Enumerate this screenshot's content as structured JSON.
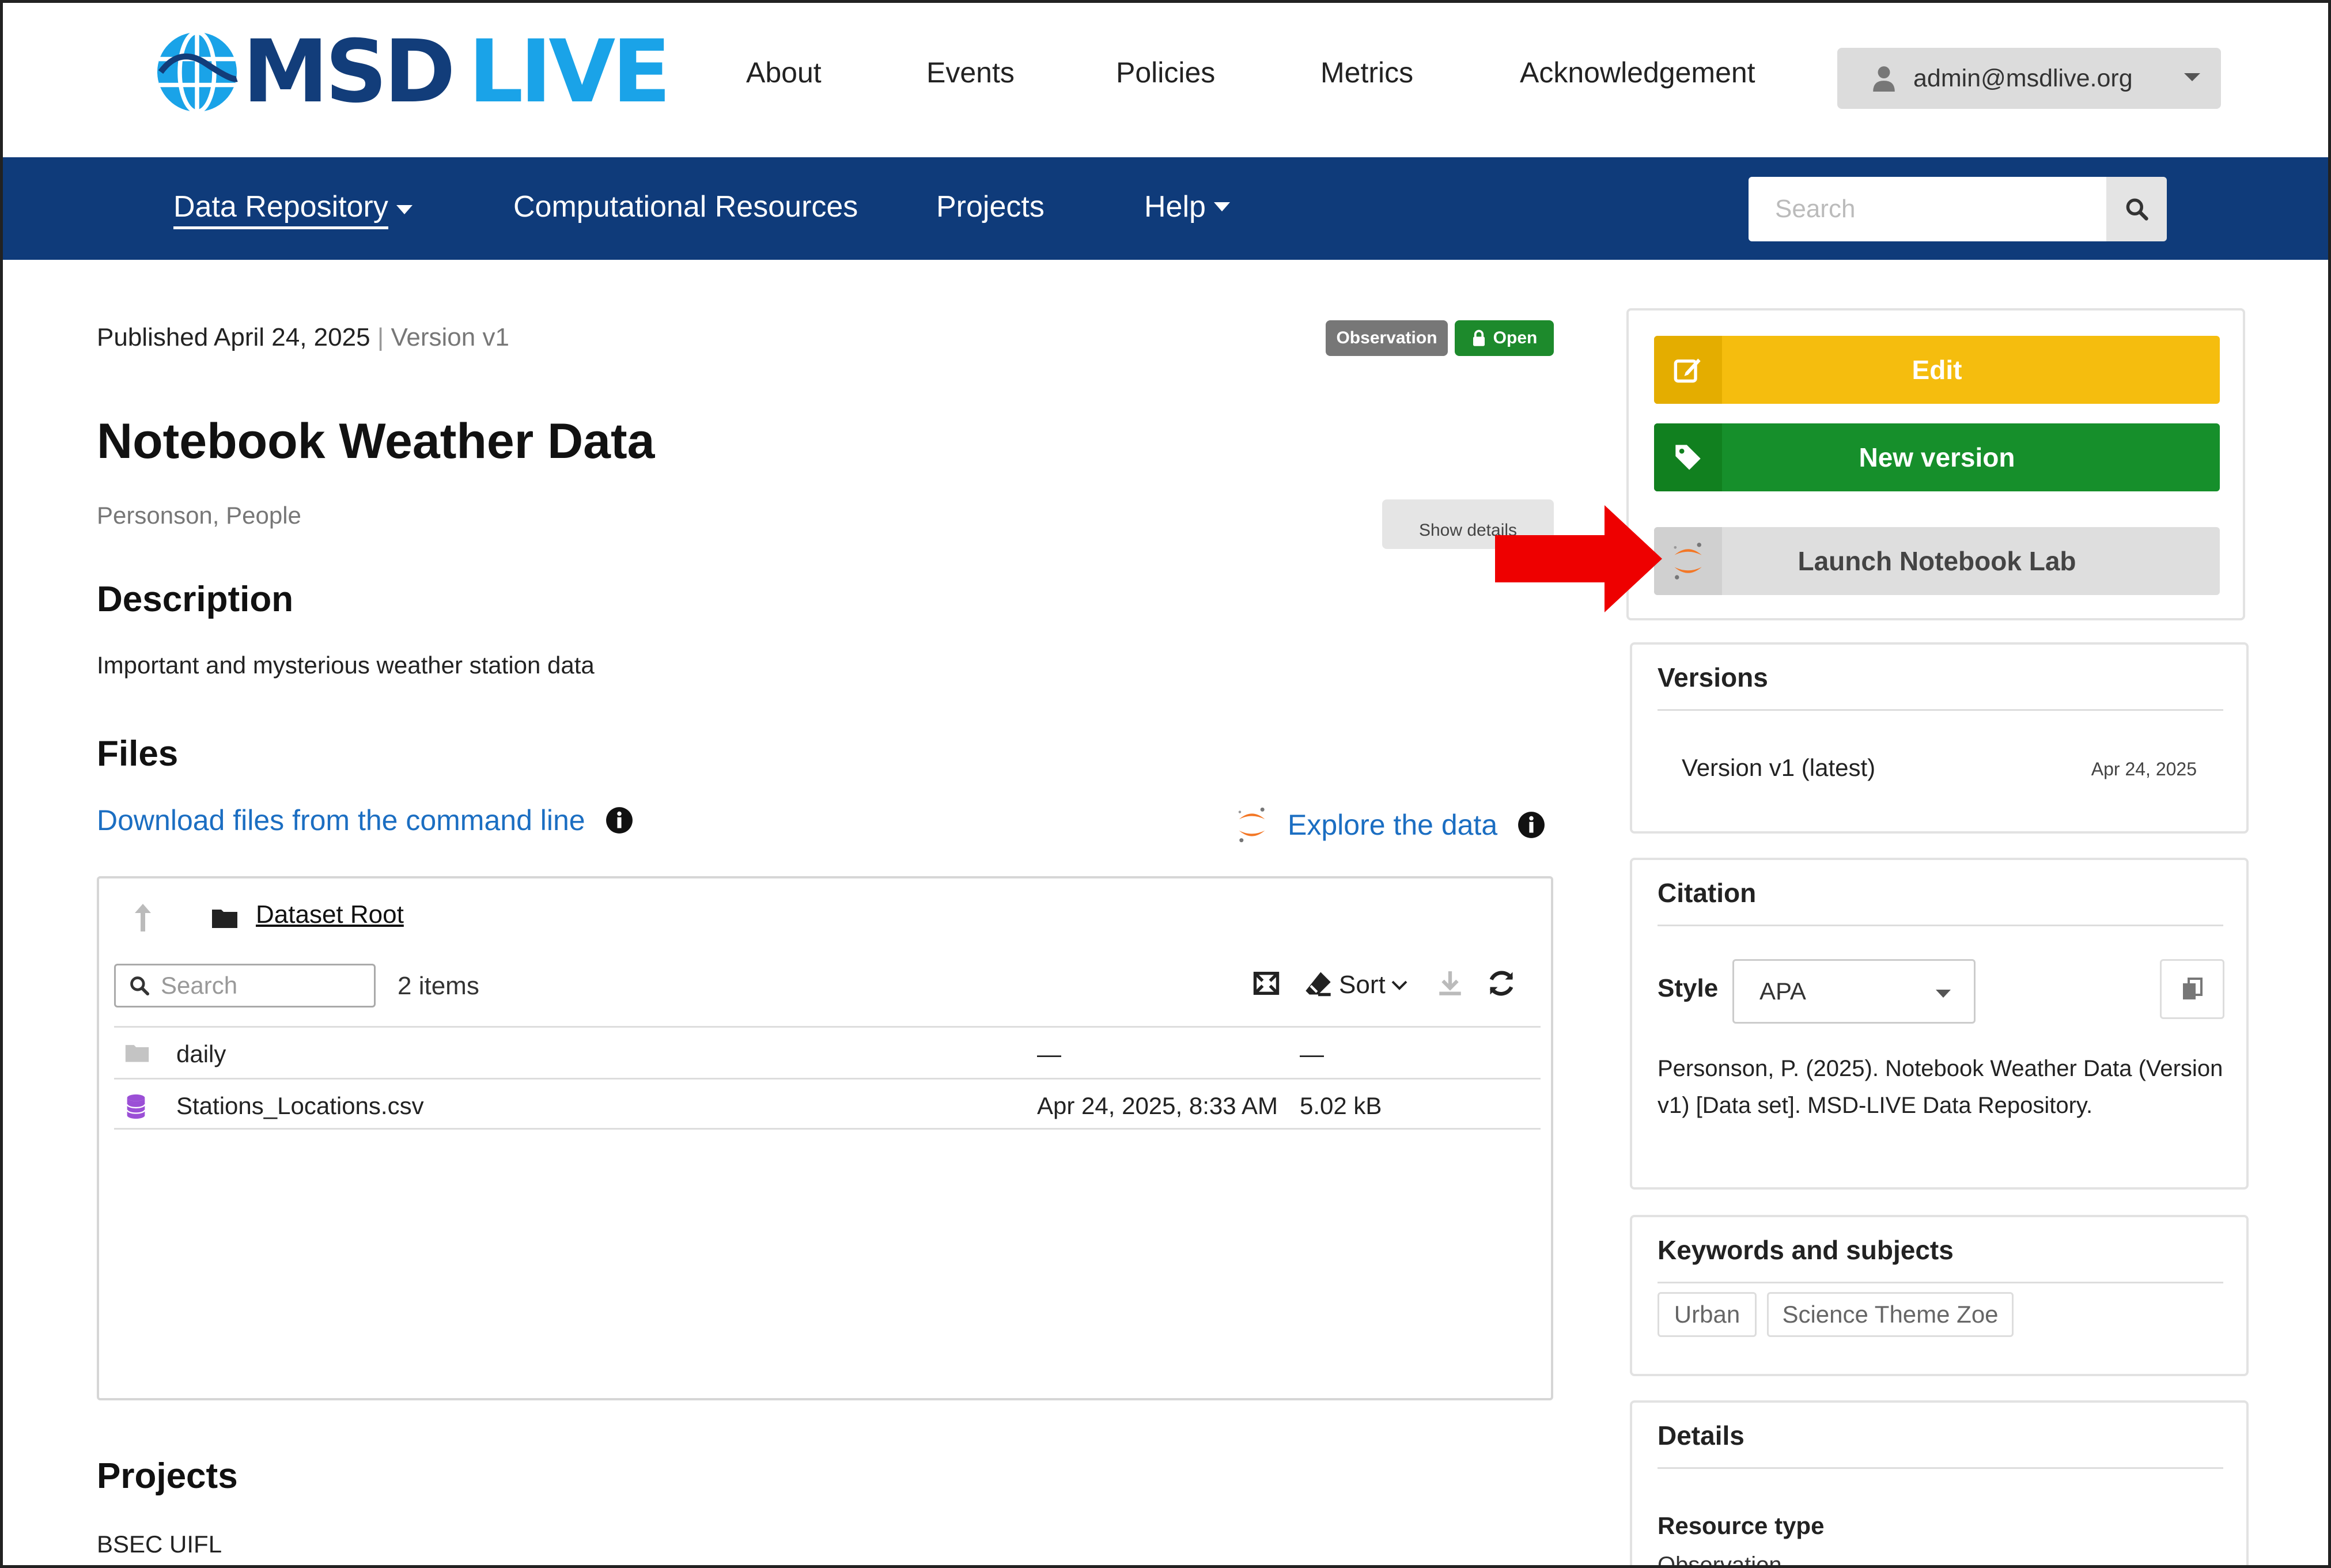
{
  "header": {
    "logo_part1": "MSD",
    "logo_part2": "LIVE",
    "nav": [
      "About",
      "Events",
      "Policies",
      "Metrics",
      "Acknowledgement"
    ],
    "user": "admin@msdlive.org"
  },
  "mainnav": {
    "items": [
      "Data Repository",
      "Computational Resources",
      "Projects",
      "Help"
    ],
    "search_placeholder": "Search"
  },
  "record": {
    "published": "Published April 24, 2025",
    "separator": "|",
    "version": "Version v1",
    "badge_type": "Observation",
    "badge_access": "Open",
    "title": "Notebook Weather Data",
    "authors": "Personson, People",
    "show_details": "Show details",
    "description_heading": "Description",
    "description": "Important and mysterious weather station data",
    "files_heading": "Files",
    "download_link": "Download files from the command line",
    "explore_link": "Explore the data",
    "projects_heading": "Projects",
    "project": "BSEC UIFL"
  },
  "file_browser": {
    "root": "Dataset Root",
    "search_placeholder": "Search",
    "count": "2 items",
    "sort_label": "Sort",
    "rows": [
      {
        "name": "daily",
        "date": "—",
        "size": "—",
        "type": "folder"
      },
      {
        "name": "Stations_Locations.csv",
        "date": "Apr 24, 2025, 8:33 AM",
        "size": "5.02 kB",
        "type": "database"
      }
    ]
  },
  "sidebar": {
    "edit": "Edit",
    "new_version": "New version",
    "launch": "Launch Notebook Lab",
    "versions_title": "Versions",
    "version_item": "Version v1 (latest)",
    "version_date": "Apr 24, 2025",
    "citation_title": "Citation",
    "style_label": "Style",
    "style_value": "APA",
    "citation_text": "Personson, P. (2025). Notebook Weather Data (Version v1) [Data set]. MSD-LIVE Data Repository.",
    "keywords_title": "Keywords and subjects",
    "keywords": [
      "Urban",
      "Science Theme Zoe"
    ],
    "details_title": "Details",
    "resource_type_label": "Resource type",
    "resource_type_value": "Observation"
  },
  "colors": {
    "brand_dark": "#123d7a",
    "brand_light": "#1aa3e8",
    "nav_bg": "#0f3b7a",
    "edit": "#f5bd0e",
    "new_version": "#168f2b",
    "link": "#1b6ec2",
    "annotation_arrow": "#ee0000"
  }
}
